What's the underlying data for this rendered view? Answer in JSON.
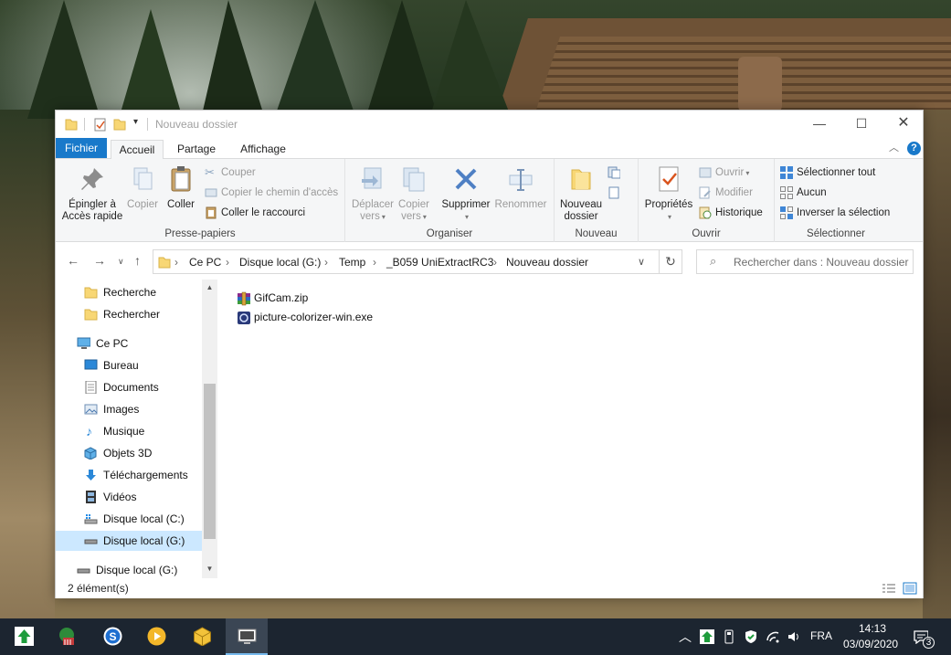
{
  "window": {
    "title": "Nouveau dossier"
  },
  "tabs": {
    "file": "Fichier",
    "home": "Accueil",
    "share": "Partage",
    "view": "Affichage",
    "help": "?"
  },
  "ribbon": {
    "clipboard": {
      "label": "Presse-papiers",
      "pin_line1": "Épingler à",
      "pin_line2": "Accès rapide",
      "copy": "Copier",
      "paste": "Coller",
      "cut": "Couper",
      "copy_path": "Copier le chemin d'accès",
      "paste_shortcut": "Coller le raccourci"
    },
    "organize": {
      "label": "Organiser",
      "move_line1": "Déplacer",
      "move_line2": "vers",
      "copy_line1": "Copier",
      "copy_line2": "vers",
      "delete": "Supprimer",
      "rename": "Renommer"
    },
    "new": {
      "label": "Nouveau",
      "new_folder_line1": "Nouveau",
      "new_folder_line2": "dossier"
    },
    "open": {
      "label": "Ouvrir",
      "properties": "Propriétés",
      "open": "Ouvrir",
      "edit": "Modifier",
      "history": "Historique"
    },
    "select": {
      "label": "Sélectionner",
      "select_all": "Sélectionner tout",
      "select_none": "Aucun",
      "invert": "Inverser la sélection"
    }
  },
  "address": {
    "crumbs": [
      "Ce PC",
      "Disque local (G:)",
      "Temp",
      "_B059 UniExtractRC3",
      "Nouveau dossier"
    ],
    "separator": "›",
    "search_placeholder": "Rechercher dans : Nouveau dossier"
  },
  "nav": {
    "items": [
      {
        "label": "Recherche"
      },
      {
        "label": "Rechercher"
      },
      {
        "label": "Ce PC"
      },
      {
        "label": "Bureau"
      },
      {
        "label": "Documents"
      },
      {
        "label": "Images"
      },
      {
        "label": "Musique"
      },
      {
        "label": "Objets 3D"
      },
      {
        "label": "Téléchargements"
      },
      {
        "label": "Vidéos"
      },
      {
        "label": "Disque local (C:)"
      },
      {
        "label": "Disque local (G:)"
      },
      {
        "label": "Disque local (G:)"
      }
    ]
  },
  "files": [
    {
      "name": "GifCam.zip",
      "icon": "winrar-archive-icon"
    },
    {
      "name": "picture-colorizer-win.exe",
      "icon": "exe-app-icon"
    }
  ],
  "status": {
    "count": "2 élément(s)"
  },
  "taskbar": {
    "language": "FRA",
    "time": "14:13",
    "date": "03/09/2020",
    "notifications": "3"
  },
  "colors": {
    "accent": "#1979ca",
    "taskbar": "#1c2530",
    "selection": "#cce8ff",
    "folder": "#f8d775"
  }
}
